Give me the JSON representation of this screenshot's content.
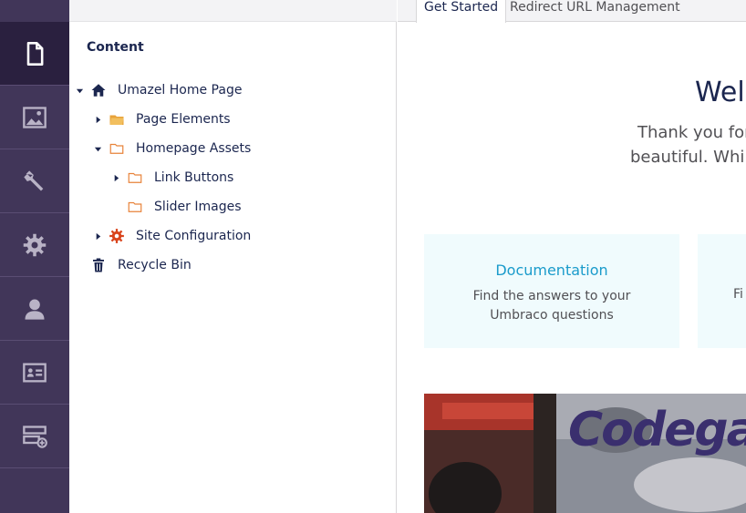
{
  "rail": {
    "items": [
      {
        "name": "content-section",
        "icon": "document-icon",
        "active": true
      },
      {
        "name": "media-section",
        "icon": "image-icon",
        "active": false
      },
      {
        "name": "settings-section",
        "icon": "wrench-icon",
        "active": false
      },
      {
        "name": "developer-section",
        "icon": "gear-icon",
        "active": false
      },
      {
        "name": "users-section",
        "icon": "user-icon",
        "active": false
      },
      {
        "name": "members-section",
        "icon": "id-card-icon",
        "active": false
      },
      {
        "name": "forms-section",
        "icon": "forms-add-icon",
        "active": false
      }
    ]
  },
  "tree": {
    "title": "Content",
    "nodes": [
      {
        "label": "Umazel Home Page",
        "icon": "home-icon",
        "expanded": true
      },
      {
        "label": "Page Elements",
        "icon": "folder-filled-icon",
        "expanded": false
      },
      {
        "label": "Homepage Assets",
        "icon": "folder-outline-icon",
        "expanded": true
      },
      {
        "label": "Link Buttons",
        "icon": "folder-outline-icon",
        "expanded": false
      },
      {
        "label": "Slider Images",
        "icon": "folder-outline-icon",
        "expanded": null
      },
      {
        "label": "Site Configuration",
        "icon": "cog-red-icon",
        "expanded": false
      },
      {
        "label": "Recycle Bin",
        "icon": "trash-icon",
        "expanded": null
      }
    ]
  },
  "main": {
    "tabs": [
      {
        "label": "Get Started",
        "active": true
      },
      {
        "label": "Redirect URL Management",
        "active": false
      }
    ],
    "welcome": "Welc",
    "thanks_line1": "Thank you for",
    "thanks_line2": "beautiful. While",
    "cards": [
      {
        "title": "Documentation",
        "text": "Find the answers to your Umbraco questions"
      },
      {
        "title": "",
        "text": "Fi"
      }
    ],
    "photo_text": "Codegarden"
  },
  "colors": {
    "rail_bg": "#413659",
    "rail_active": "#2a203f",
    "link": "#1a9bcb",
    "text": "#1b264f",
    "folder": "#e8a33a",
    "cog": "#d9441c"
  }
}
